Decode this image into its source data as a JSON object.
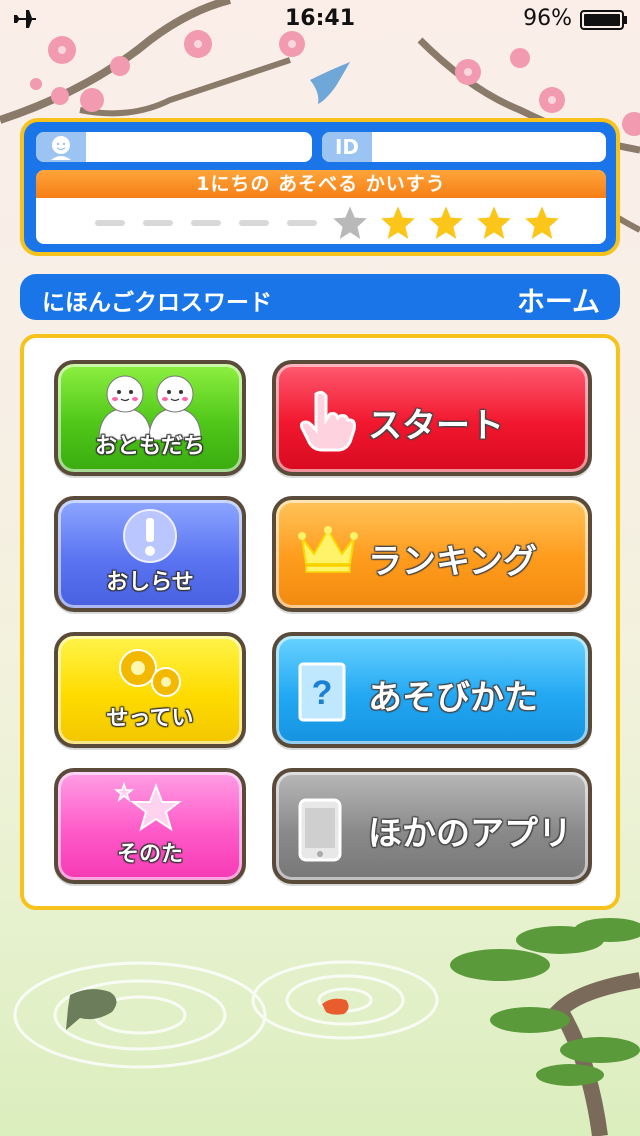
{
  "status_bar": {
    "time": "16:41",
    "battery_percent": "96%"
  },
  "profile": {
    "name_value": "",
    "id_tag": "ID",
    "id_value": "",
    "daily_plays": {
      "title": "1にちの あそべる かいすう",
      "total": 10,
      "used_dashes": 5,
      "empty_stars": 1,
      "filled_stars": 4
    }
  },
  "header": {
    "app_title": "にほんごクロスワード",
    "home_label": "ホーム"
  },
  "menu": {
    "friends": "おともだち",
    "news": "おしらせ",
    "settings": "せってい",
    "other": "そのた",
    "start": "スタート",
    "ranking": "ランキング",
    "how_to_play": "あそびかた",
    "other_apps": "ほかのアプリ"
  },
  "colors": {
    "primary_blue": "#1a76e8",
    "frame_yellow": "#f6c21b",
    "star_gold": "#fcc51a",
    "star_gray": "#b9b9b9"
  }
}
